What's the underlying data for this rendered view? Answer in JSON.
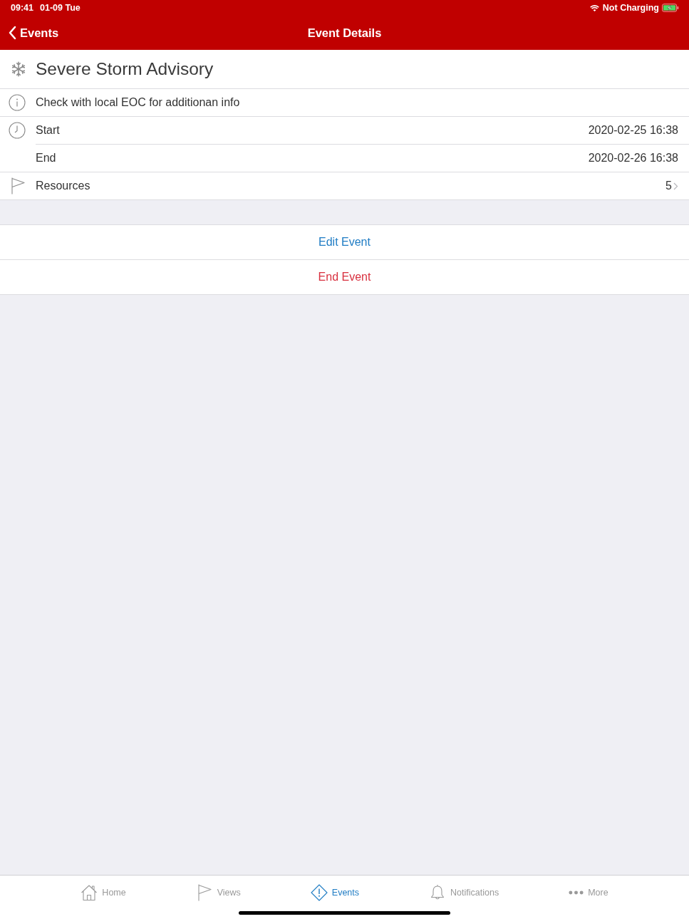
{
  "status_bar": {
    "time": "09:41",
    "date": "01-09 Tue",
    "charging_text": "Not Charging"
  },
  "nav_bar": {
    "back_label": "Events",
    "title": "Event Details"
  },
  "event": {
    "title": "Severe Storm Advisory"
  },
  "details": [
    {
      "kind": "info",
      "label": "Check with local EOC for additionan info"
    },
    {
      "kind": "start",
      "label": "Start",
      "value": "2020-02-25 16:38"
    },
    {
      "kind": "end",
      "label": "End",
      "value": "2020-02-26 16:38"
    },
    {
      "kind": "resources",
      "label": "Resources",
      "value": "5",
      "disclosure": true
    }
  ],
  "actions": [
    {
      "kind": "edit",
      "label": "Edit Event"
    },
    {
      "kind": "end",
      "label": "End Event"
    }
  ],
  "tab_bar": [
    {
      "kind": "home",
      "label": "Home",
      "selected": false
    },
    {
      "kind": "views",
      "label": "Views",
      "selected": false
    },
    {
      "kind": "events",
      "label": "Events",
      "selected": true
    },
    {
      "kind": "notifications",
      "label": "Notifications",
      "selected": false
    },
    {
      "kind": "more",
      "label": "More",
      "selected": false
    }
  ]
}
